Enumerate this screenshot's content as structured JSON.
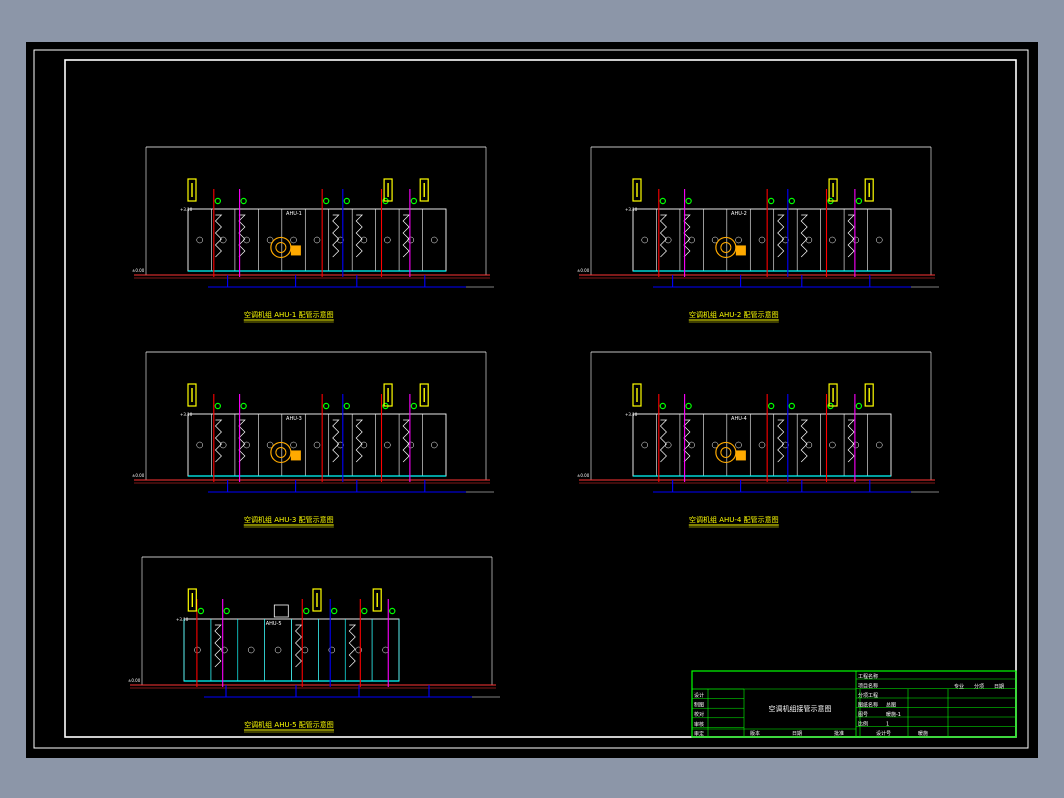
{
  "viewer": {
    "background": "#8c96a8",
    "sheet_background": "#000000"
  },
  "colors": {
    "frame": "#ffffff",
    "title_block": "#00ff00",
    "duct": "#ffffff",
    "floor": "#ff3333",
    "pipe_blue": "#0000ff",
    "pipe_magenta": "#ff00ff",
    "pipe_red": "#ff0000",
    "valve_green": "#00ff00",
    "sensor_yellow": "#ffff00",
    "cyan": "#00ffff",
    "fan_orange": "#ffaa00",
    "caption": "#ffff00"
  },
  "drawings": [
    {
      "id": "ahu-1",
      "caption": "空调机组 AHU-1 配管示意图",
      "unit_tag": "AHU-1"
    },
    {
      "id": "ahu-2",
      "caption": "空调机组 AHU-2 配管示意图",
      "unit_tag": "AHU-2"
    },
    {
      "id": "ahu-3",
      "caption": "空调机组 AHU-3 配管示意图",
      "unit_tag": "AHU-3"
    },
    {
      "id": "ahu-4",
      "caption": "空调机组 AHU-4 配管示意图",
      "unit_tag": "AHU-4"
    },
    {
      "id": "ahu-5",
      "caption": "空调机组 AHU-5 配管示意图",
      "unit_tag": "AHU-5"
    }
  ],
  "title_block": {
    "drawing_name": "空调机组接管示意图",
    "labels_left": [
      "设计",
      "制图",
      "校对",
      "审核",
      "审定"
    ],
    "labels_right": [
      "工程名称",
      "项目名称",
      "分项工程",
      "图纸名称",
      "图号",
      "比例"
    ],
    "values_right": [
      "",
      "",
      "",
      "总图",
      "暖施-1",
      "1"
    ],
    "bottom_row": [
      "版本",
      "日期",
      "批准",
      "设计号",
      "暖施"
    ],
    "header_cols": [
      "专业",
      "分项",
      "日期"
    ]
  }
}
